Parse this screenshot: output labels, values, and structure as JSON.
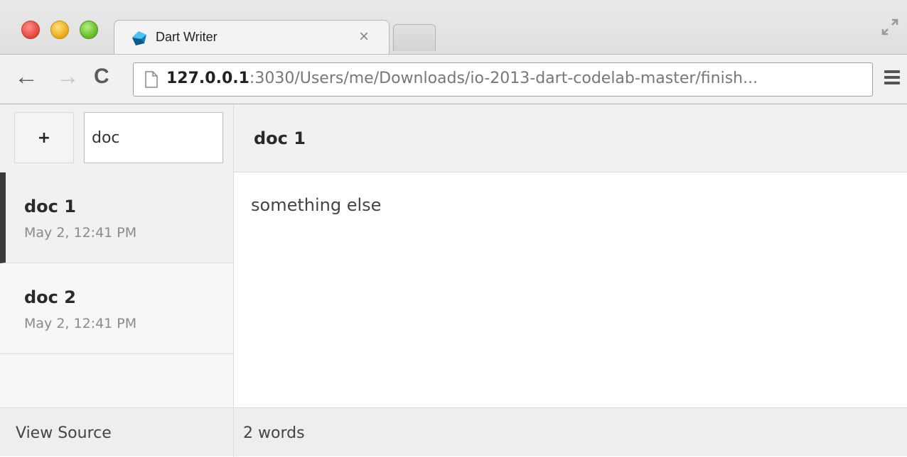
{
  "browser": {
    "tab": {
      "title": "Dart Writer",
      "close_glyph": "×",
      "favicon": "dart-logo-icon"
    },
    "nav": {
      "back_glyph": "←",
      "forward_glyph": "→",
      "reload_glyph": "C"
    },
    "address_bar": {
      "host": "127.0.0.1",
      "rest": ":3030/Users/me/Downloads/io-2013-dart-codelab-master/finish..."
    }
  },
  "app": {
    "toolbar": {
      "add_label": "+",
      "search_value": "doc"
    },
    "documents": [
      {
        "title": "doc 1",
        "date": "May 2, 12:41 PM",
        "active": true
      },
      {
        "title": "doc 2",
        "date": "May 2, 12:41 PM",
        "active": false
      }
    ],
    "editor": {
      "title": "doc 1",
      "content": "something else"
    },
    "footer": {
      "view_source_label": "View Source",
      "word_count": "2 words"
    }
  },
  "colors": {
    "active_marker": "#3a3a3a",
    "panel_bg": "#f1f1f1",
    "close_light": "#e0443c",
    "minimize_light": "#e7a816",
    "maximize_light": "#5fb62a"
  }
}
